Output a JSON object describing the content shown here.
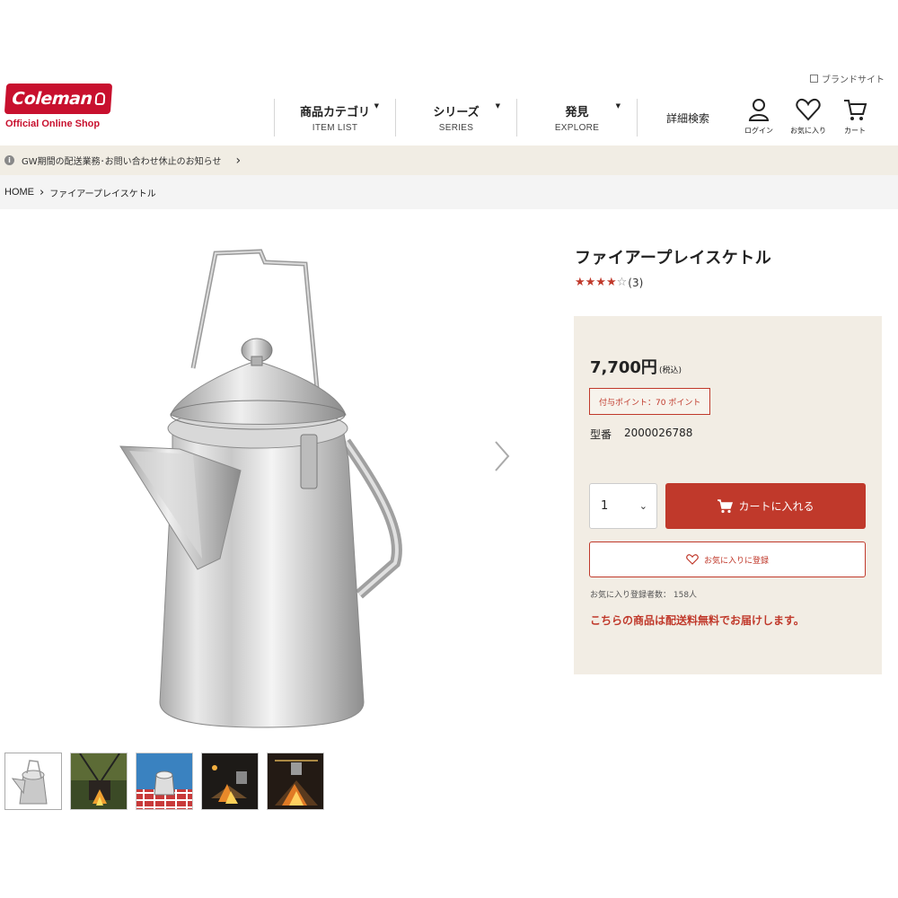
{
  "header": {
    "brand_site_link": "ブランドサイト",
    "logo_text": "Coleman",
    "logo_sub": "Official Online Shop",
    "nav": [
      {
        "jp": "商品カテゴリ",
        "en": "ITEM LIST"
      },
      {
        "jp": "シリーズ",
        "en": "SERIES"
      },
      {
        "jp": "発見",
        "en": "EXPLORE"
      }
    ],
    "detail_search": "詳細検索",
    "util": {
      "login": "ログイン",
      "favorites": "お気に入り",
      "cart": "カート"
    }
  },
  "notice": {
    "text": "GW期間の配送業務･お問い合わせ休止のお知らせ",
    "info_icon": "i",
    "chevron": "›"
  },
  "breadcrumb": {
    "home": "HOME",
    "sep": "›",
    "current": "ファイアープレイスケトル"
  },
  "product": {
    "title": "ファイアープレイスケトル",
    "rating": {
      "value": 4,
      "max": 5,
      "stars_filled": "★★★★",
      "stars_empty": "☆",
      "count": "(3)"
    },
    "price": "7,700円",
    "tax": "(税込)",
    "points": "付与ポイント：70 ポイント",
    "model_label": "型番",
    "model_number": "2000026788",
    "qty_value": "1",
    "qty_icon": "chevron-down-icon",
    "cart_button": "カートに入れる",
    "fav_button": "お気に入りに登録",
    "fav_count": "お気に入り登録者数： 158人",
    "shipping": "こちらの商品は配送料無料でお届けします。"
  },
  "gallery": {
    "thumbnails": [
      "kettle-white",
      "campfire-hanging",
      "picnic-blue",
      "fire-night-1",
      "fire-night-2"
    ],
    "active_index": 0,
    "next_icon": "chevron-right-icon"
  },
  "colors": {
    "brand_red": "#c8102e",
    "accent_red": "#c0392b",
    "notice_bg": "#f1ede4",
    "buy_box_bg": "#f2ede4"
  }
}
